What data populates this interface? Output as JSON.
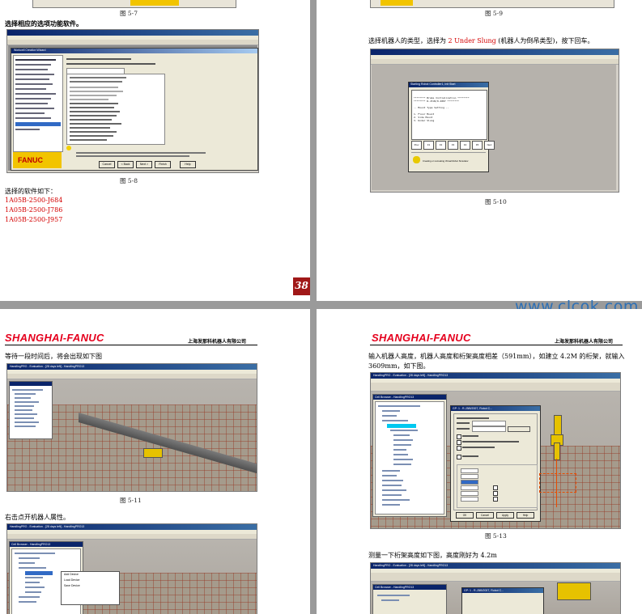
{
  "page1": {
    "top_caption": "图 5-7",
    "heading": "选择相应的选项功能软件。",
    "wizard_title": "Workcell Creation Wizard",
    "wizard_logo": "FANUC",
    "wizard_buttons": [
      "Cancel",
      "< Back",
      "Next >",
      "Finish",
      "Help"
    ],
    "caption": "图 5-8",
    "list_intro": "选择的软件如下：",
    "software": [
      "1A05B-2500-J684",
      "1A05B-2500-J786",
      "1A05B-2500-J957"
    ],
    "page_number": "38"
  },
  "page2": {
    "top_caption": "图 5-9",
    "text_before": "选择机器人的类型，选择为 ",
    "text_highlight": "2 Under Slung",
    "text_after": " (机器人为倒吊类型)，按下回车。",
    "console_title": "Starting Robot Controller1, Init Start",
    "console_lines": [
      "******** Brake Initialization ********",
      "******** R-J3iB/9-2007 ********",
      "-- Mount Type Setting --",
      "1. Floor Mount",
      "2. Side Mount",
      "3. Under Slung"
    ],
    "function_keys": [
      "Prev",
      "F1",
      "F2",
      "F3",
      "F4",
      "F5",
      "Next"
    ],
    "status_text": "Creating or recreating Virtual Robot Simulator",
    "caption": "图 5-10"
  },
  "watermark": "www.clcok.com",
  "page3": {
    "brand": "SHANGHAI-FANUC",
    "company": "上海发那科机器人有限公司",
    "line1": "等待一段时间后，将会出现如下图",
    "caption": "图 5-11",
    "line2": "右击点开机器人属性。",
    "context_menu": [
      "Add Device",
      "Load Device",
      "Save Device"
    ]
  },
  "page4": {
    "brand": "SHANGHAI-FANUC",
    "company": "上海发那科机器人有限公司",
    "line1": "输入机器人高度，机器人高度和桁架高度相差（591mm），如建立 4.2M 的桁架，就输入",
    "line2": "3609mm，如下图。",
    "dialog_title": "GP: 1 - R-J3iB/2007, Robot C...",
    "dialog_buttons": [
      "OK",
      "Cancel",
      "Apply",
      "Help"
    ],
    "caption": "图 5-13",
    "line3": "测量一下桁架高度如下图，高度刚好为 4.2m"
  },
  "app_title": "HandlingPRO - Evaluation - [28 days left] - HandlingPRO13",
  "cell_browser_title": "Cell Browser - HandlingPRO13"
}
